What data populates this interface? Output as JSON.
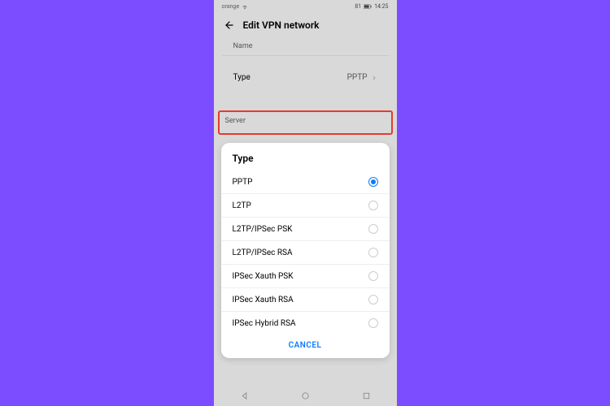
{
  "status": {
    "time": "14:25",
    "battery": "81"
  },
  "header": {
    "title": "Edit VPN network"
  },
  "name_field": {
    "label": "Name"
  },
  "type_row": {
    "label": "Type",
    "value": "PPTP"
  },
  "server_field": {
    "label": "Server"
  },
  "modal": {
    "title": "Type",
    "options": [
      {
        "label": "PPTP",
        "selected": true
      },
      {
        "label": "L2TP",
        "selected": false
      },
      {
        "label": "L2TP/IPSec PSK",
        "selected": false
      },
      {
        "label": "L2TP/IPSec RSA",
        "selected": false
      },
      {
        "label": "IPSec Xauth PSK",
        "selected": false
      },
      {
        "label": "IPSec Xauth RSA",
        "selected": false
      },
      {
        "label": "IPSec Hybrid RSA",
        "selected": false
      }
    ],
    "cancel": "CANCEL"
  }
}
